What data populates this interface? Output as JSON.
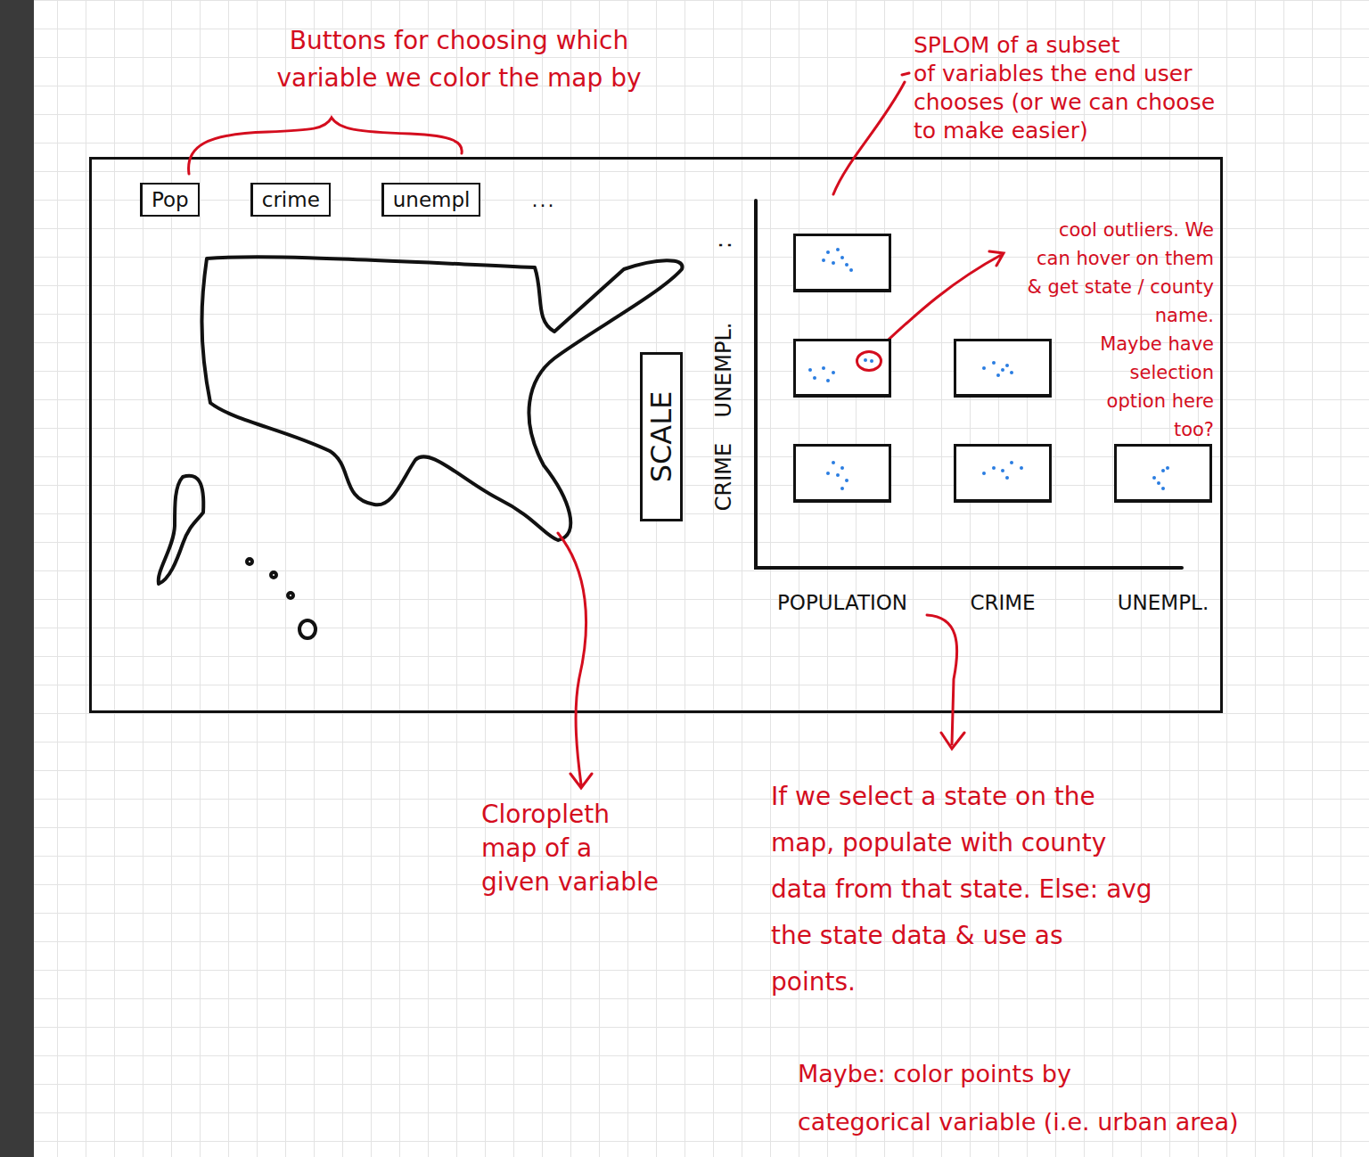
{
  "annotations": [
    {
      "lines": [
        "Buttons for choosing which",
        "variable we color the map by"
      ]
    },
    {
      "lines": [
        "SPLOM of a subset",
        "of variables the end user",
        "chooses (or we can choose",
        "to make easier)"
      ]
    },
    {
      "lines": [
        "cool outliers. We",
        "can hover on them",
        "& get state / county",
        "name.",
        "Maybe have",
        "selection",
        "option here",
        "too?"
      ]
    },
    {
      "lines": [
        "Cloropleth",
        "map of a",
        "given variable"
      ]
    },
    {
      "lines": [
        "If we select a state on the",
        "map, populate with county",
        "data from that state. Else: avg",
        "the state data & use as",
        "points."
      ]
    },
    {
      "lines": [
        "Maybe: color points by",
        "categorical variable (i.e. urban area)"
      ]
    }
  ],
  "buttons": [
    {
      "label": "Pop",
      "selected": false
    },
    {
      "label": "crime",
      "selected": false
    },
    {
      "label": "unempl",
      "selected": false
    }
  ],
  "more": "...",
  "scale": "SCALE",
  "splom": {
    "y_labels": [
      ":",
      "UNEMPL.",
      "CRIME"
    ],
    "x_labels": [
      "POPULATION",
      "CRIME",
      "UNEMPL."
    ],
    "rows": [
      [
        {
          "points": [
            {
              "x": 0.35,
              "y": 0.7,
              "outlier": false
            },
            {
              "x": 0.45,
              "y": 0.75,
              "outlier": false
            },
            {
              "x": 0.5,
              "y": 0.6,
              "outlier": false
            },
            {
              "x": 0.4,
              "y": 0.5,
              "outlier": false
            },
            {
              "x": 0.55,
              "y": 0.45,
              "outlier": false
            },
            {
              "x": 0.6,
              "y": 0.35,
              "outlier": false
            },
            {
              "x": 0.3,
              "y": 0.55,
              "outlier": false
            }
          ]
        }
      ],
      [
        {
          "points": [
            {
              "x": 0.2,
              "y": 0.3,
              "outlier": false
            },
            {
              "x": 0.3,
              "y": 0.5,
              "outlier": false
            },
            {
              "x": 0.15,
              "y": 0.45,
              "outlier": false
            },
            {
              "x": 0.35,
              "y": 0.25,
              "outlier": false
            },
            {
              "x": 0.4,
              "y": 0.4,
              "outlier": false
            },
            {
              "x": 0.75,
              "y": 0.65,
              "outlier": true
            },
            {
              "x": 0.82,
              "y": 0.62,
              "outlier": true
            }
          ]
        },
        {
          "points": [
            {
              "x": 0.3,
              "y": 0.5,
              "outlier": false
            },
            {
              "x": 0.4,
              "y": 0.6,
              "outlier": false
            },
            {
              "x": 0.5,
              "y": 0.45,
              "outlier": false
            },
            {
              "x": 0.55,
              "y": 0.55,
              "outlier": false
            },
            {
              "x": 0.45,
              "y": 0.35,
              "outlier": false
            },
            {
              "x": 0.6,
              "y": 0.4,
              "outlier": false
            }
          ]
        }
      ],
      [
        {
          "points": [
            {
              "x": 0.4,
              "y": 0.7,
              "outlier": false
            },
            {
              "x": 0.5,
              "y": 0.6,
              "outlier": false
            },
            {
              "x": 0.45,
              "y": 0.45,
              "outlier": false
            },
            {
              "x": 0.55,
              "y": 0.35,
              "outlier": false
            },
            {
              "x": 0.35,
              "y": 0.5,
              "outlier": false
            },
            {
              "x": 0.5,
              "y": 0.2,
              "outlier": false
            }
          ]
        },
        {
          "points": [
            {
              "x": 0.3,
              "y": 0.5,
              "outlier": false
            },
            {
              "x": 0.4,
              "y": 0.6,
              "outlier": false
            },
            {
              "x": 0.5,
              "y": 0.55,
              "outlier": false
            },
            {
              "x": 0.6,
              "y": 0.7,
              "outlier": false
            },
            {
              "x": 0.55,
              "y": 0.4,
              "outlier": false
            },
            {
              "x": 0.7,
              "y": 0.6,
              "outlier": false
            }
          ]
        },
        {
          "points": [
            {
              "x": 0.4,
              "y": 0.4,
              "outlier": false
            },
            {
              "x": 0.5,
              "y": 0.55,
              "outlier": false
            },
            {
              "x": 0.45,
              "y": 0.3,
              "outlier": false
            },
            {
              "x": 0.55,
              "y": 0.6,
              "outlier": false
            },
            {
              "x": 0.5,
              "y": 0.2,
              "outlier": false
            }
          ]
        }
      ]
    ]
  }
}
